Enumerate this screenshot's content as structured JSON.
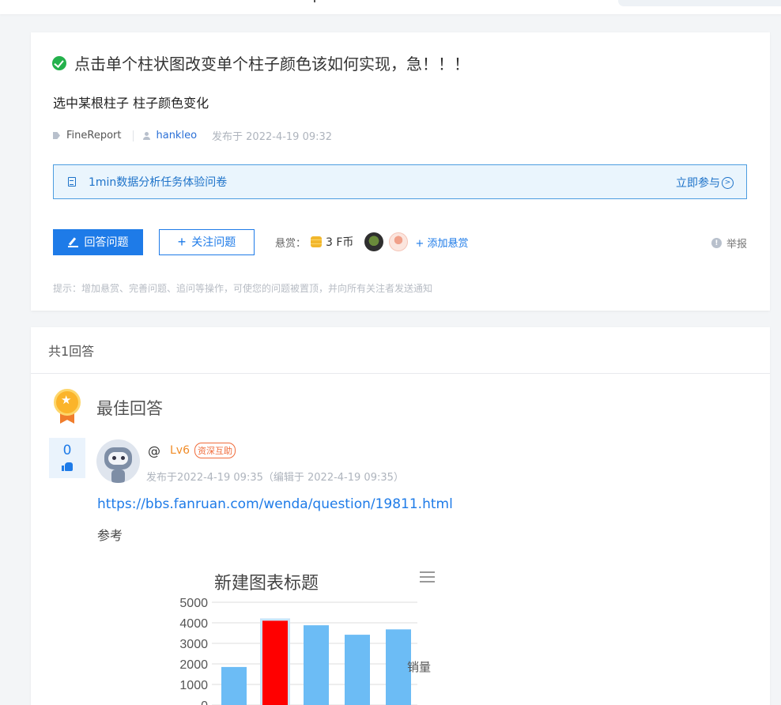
{
  "question": {
    "title": "点击单个柱状图改变单个柱子颜色该如何实现，急！！！",
    "body": "选中某根柱子 柱子颜色变化",
    "tag": "FineReport",
    "author": "hankleo",
    "published": "发布于 2022-4-19 09:32",
    "banner_text": "1min数据分析任务体验问卷",
    "banner_action": "立即参与",
    "answer_button": "回答问题",
    "follow_button": "关注问题",
    "bounty_label": "悬赏：",
    "bounty_amount": "3 F币",
    "add_bounty": "+ 添加悬赏",
    "report": "举报",
    "tip": "提示：增加悬赏、完善问题、追问等操作，可使您的问题被置顶，并向所有关注者发送通知"
  },
  "answers": {
    "count_label": "共1回答",
    "best_label": "最佳回答",
    "best": {
      "votes": "0",
      "at": "@",
      "level": "Lv6",
      "badge": "资深互助",
      "time": "发布于2022-4-19 09:35（编辑于 2022-4-19 09:35）",
      "link": "https://bbs.fanruan.com/wenda/question/19811.html",
      "text": "参考"
    }
  },
  "colors": {
    "accent": "#1e7be8",
    "success": "#24b14c",
    "bar": "#6cbcf5",
    "highlight_bar": "#ff0000"
  },
  "chart_data": {
    "type": "bar",
    "title": "新建图表标题",
    "series": [
      {
        "name": "销量",
        "values": [
          1850,
          4100,
          3880,
          3420,
          3680
        ]
      }
    ],
    "highlight_index": 1,
    "ylim": [
      0,
      5000
    ],
    "yticks": [
      "5000",
      "4000",
      "3000",
      "2000",
      "1000",
      "0"
    ],
    "legend": "right",
    "menu_icon": "hamburger-icon"
  }
}
